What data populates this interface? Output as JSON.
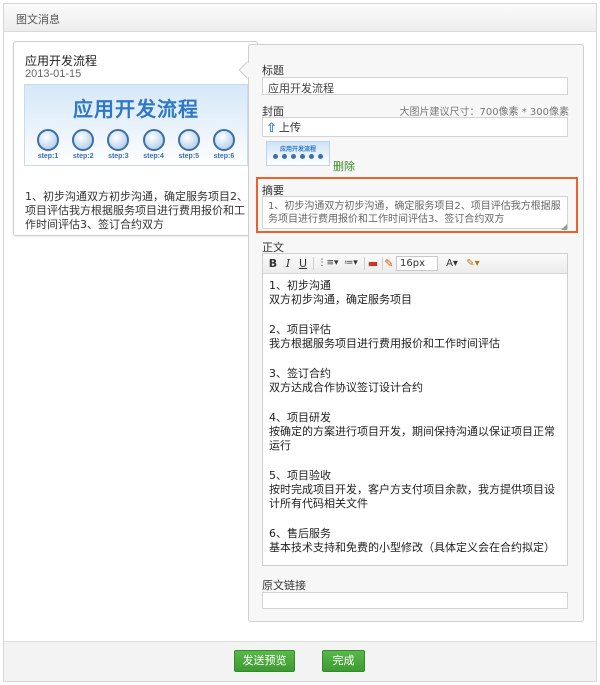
{
  "window": {
    "title": "图文消息"
  },
  "preview": {
    "title": "应用开发流程",
    "date": "2013-01-15",
    "banner_title": "应用开发流程",
    "steps": [
      "step:1",
      "step:2",
      "step:3",
      "step:4",
      "step:5",
      "step:6"
    ],
    "summary": "1、初步沟通双方初步沟通，确定服务项目2、项目评估我方根据服务项目进行费用报价和工作时间评估3、签订合约双方"
  },
  "form": {
    "title_label": "标题",
    "title_value": "应用开发流程",
    "cover_label": "封面",
    "cover_hint": "大图片建议尺寸：700像素 * 300像素",
    "upload_label": "上传",
    "thumb_text": "应用开发流程",
    "delete_label": "删除",
    "summary_label": "摘要",
    "summary_value": "1、初步沟通双方初步沟通，确定服务项目2、项目评估我方根据服务项目进行费用报价和工作时间评估3、签订合约双方",
    "body_label": "正文",
    "link_label": "原文链接",
    "link_value": ""
  },
  "toolbar": {
    "bold": "B",
    "italic": "I",
    "underline": "U",
    "ordered_list": "⋮≡▾",
    "unordered_list": "≔▾",
    "image": "▬",
    "eraser": "✎",
    "font_size": "16px",
    "font_color": "A▾",
    "bg_color": "✎▾"
  },
  "editor_sections": [
    {
      "heading": "1、初步沟通",
      "body": "双方初步沟通，确定服务项目"
    },
    {
      "heading": "2、项目评估",
      "body": "我方根据服务项目进行费用报价和工作时间评估"
    },
    {
      "heading": "3、签订合约",
      "body": "双方达成合作协议签订设计合约"
    },
    {
      "heading": "4、项目研发",
      "body": "按确定的方案进行项目开发，期间保持沟通以保证项目正常运行"
    },
    {
      "heading": "5、项目验收",
      "body": "按时完成项目开发，客户方支付项目余款，我方提供项目设计所有代码相关文件"
    },
    {
      "heading": "6、售后服务",
      "body": "基本技术支持和免费的小型修改（具体定义会在合约拟定）"
    }
  ],
  "buttons": {
    "preview": "发送预览",
    "done": "完成"
  },
  "colors": {
    "accent_green": "#48a83c",
    "highlight_orange": "#e8622a",
    "brand_blue": "#2e78c8"
  }
}
